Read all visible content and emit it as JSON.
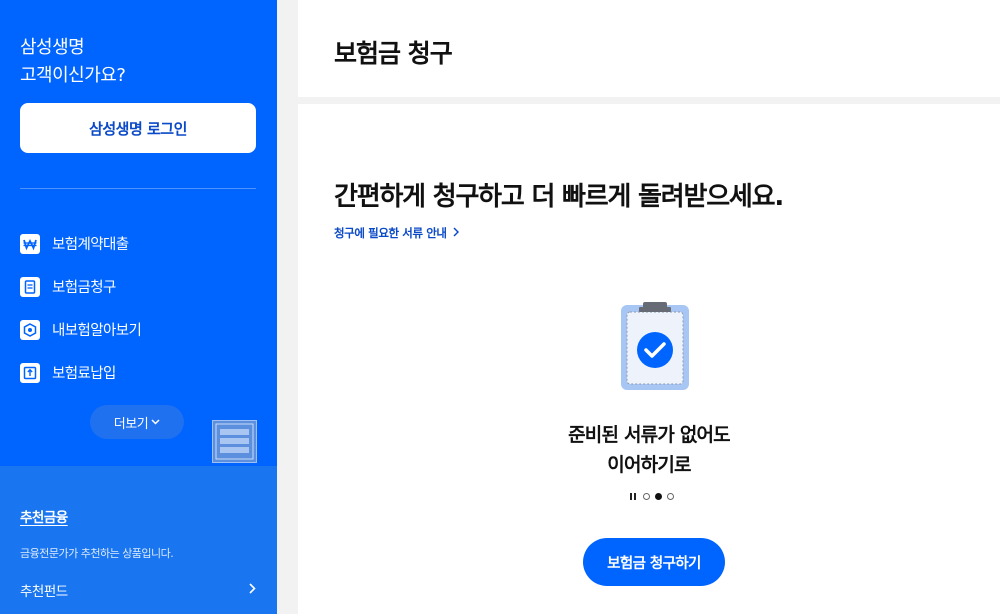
{
  "sidebar": {
    "greeting_line1": "삼성생명",
    "greeting_line2": "고객이신가요?",
    "login_label": "삼성생명 로그인",
    "menu": [
      {
        "label": "보험계약대출",
        "icon": "won-icon"
      },
      {
        "label": "보험금청구",
        "icon": "document-icon"
      },
      {
        "label": "내보험알아보기",
        "icon": "shield-icon"
      },
      {
        "label": "보험료납입",
        "icon": "payment-icon"
      }
    ],
    "more_label": "더보기",
    "recommend": {
      "title": "추천금융",
      "description": "금융전문가가 추천하는 상품입니다.",
      "item_label": "추천펀드"
    },
    "colors": {
      "background": "#0064ff",
      "recommend_bg": "#1976f0"
    }
  },
  "header": {
    "title": "보험금 청구"
  },
  "main": {
    "headline": "간편하게 청구하고 더 빠르게 돌려받으세요.",
    "doc_link": "청구에 필요한 서류 안내",
    "caption_line1": "준비된 서류가 없어도",
    "caption_line2": "이어하기로",
    "pager": {
      "total": 3,
      "active": 2
    },
    "cta_label": "보험금 청구하기",
    "accent": "#0064ff"
  }
}
